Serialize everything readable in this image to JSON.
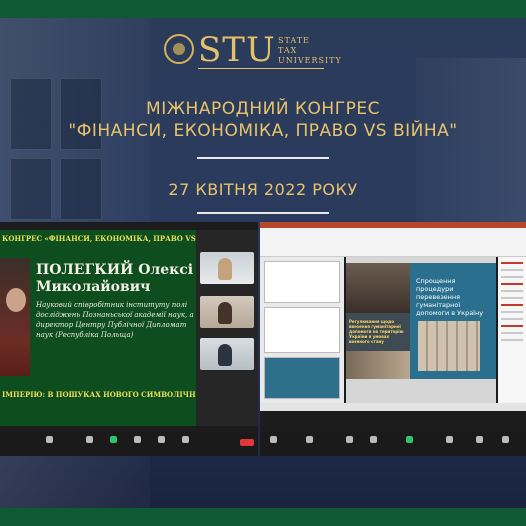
{
  "logo": {
    "abbr": "STU",
    "full": [
      "STATE",
      "TAX",
      "UNIVERSITY"
    ]
  },
  "congress": {
    "title_line1": "МІЖНАРОДНИЙ КОНГРЕС",
    "title_line2": "\"ФІНАНСИ, ЕКОНОМІКА, ПРАВО VS ВІЙНА\"",
    "date": "27 КВІТНЯ 2022 РОКУ"
  },
  "left_screen": {
    "header": "КОНГРЕС «ФІНАНСИ, ЕКОНОМІКА, ПРАВО VS ВІЙ",
    "speaker_surname": "ПОЛЕГКИЙ Олексі",
    "speaker_given": "Миколайович",
    "bio": [
      "Науковий співробітник інституту полі",
      "досліджень Познаньської академії наук, ак",
      "директор Центру Публічної Дипломат",
      "наук (Республіка Польща)"
    ],
    "footer": "ІМПЕРІЮ: В ПОШУКАХ НОВОГО СИМВОЛІЧНОГО"
  },
  "right_screen": {
    "slide_heading": "Спрощення процедури перевезення гуманітарної допомоги в Україну",
    "slide_caption": "Регулювання щодо ввезення гуманітарної допомоги на територію України в умовах воєнного стану"
  },
  "colors": {
    "frame": "#0f5a35",
    "gold": "#e7c36c",
    "slide_green": "#0e4d1d",
    "slide_teal": "#2a6f8e",
    "leave_red": "#e0383a"
  }
}
